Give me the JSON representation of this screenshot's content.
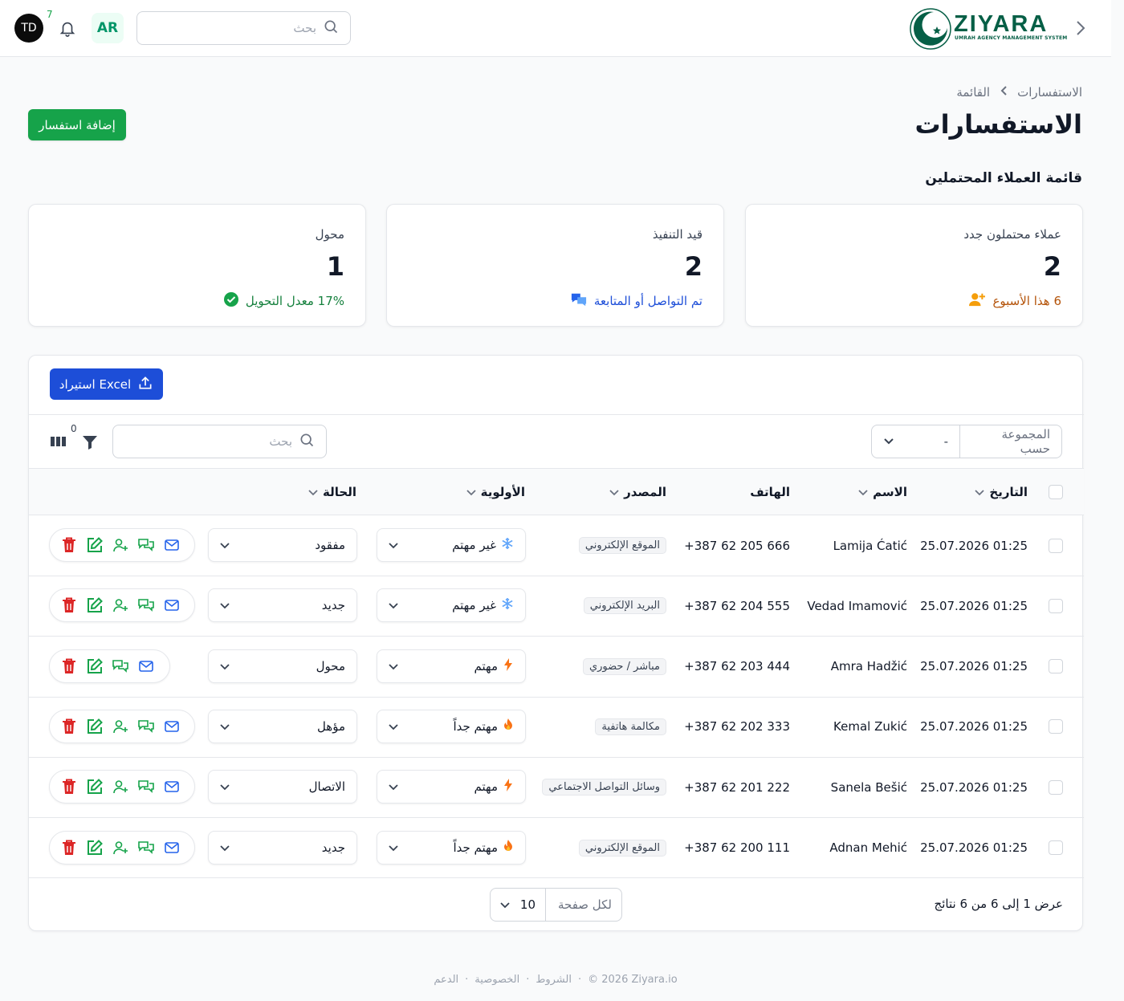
{
  "topbar": {
    "user_initials": "TD",
    "notifications_count": "7",
    "language": "AR",
    "search_placeholder": "بحث",
    "logo_text": "ZIYARA",
    "logo_subtitle": "UMRAH AGENCY MANAGEMENT SYSTEM"
  },
  "breadcrumb": {
    "root": "الاستفسارات",
    "current": "القائمة"
  },
  "page": {
    "title": "الاستفسارات",
    "subtitle": "قائمة العملاء المحتملين",
    "add_button": "إضافة استفسار"
  },
  "cards": [
    {
      "label": "عملاء محتملون جدد",
      "value": "2",
      "footer": "6 هذا الأسبوع",
      "footer_color": "#b45309",
      "icon": "user-plus-icon"
    },
    {
      "label": "قيد التنفيذ",
      "value": "2",
      "footer": "تم التواصل أو المتابعة",
      "footer_color": "#1d4ed8",
      "icon": "chat-bubbles-icon"
    },
    {
      "label": "محول",
      "value": "1",
      "footer": "17% معدل التحويل",
      "footer_color": "#15803d",
      "icon": "check-circle-icon"
    }
  ],
  "table_toolbar": {
    "excel_button": "استيراد Excel",
    "group_by_label": "المجموعة حسب",
    "group_by_value": "-",
    "search_placeholder": "بحث",
    "filter_count": "0"
  },
  "columns": {
    "date": "التاريخ",
    "name": "الاسم",
    "phone": "الهاتف",
    "source": "المصدر",
    "priority": "الأولوية",
    "status": "الحالة"
  },
  "rows": [
    {
      "date": "25.07.2026 01:25",
      "name": "Lamija Ćatić",
      "phone": "+387 62 205 666",
      "source": "الموقع الإلكتروني",
      "priority": "غير مهتم",
      "priority_icon": "snowflake-icon",
      "status": "مفقود",
      "convert": true
    },
    {
      "date": "25.07.2026 01:25",
      "name": "Vedad Imamović",
      "phone": "+387 62 204 555",
      "source": "البريد الإلكتروني",
      "priority": "غير مهتم",
      "priority_icon": "snowflake-icon",
      "status": "جديد",
      "convert": true
    },
    {
      "date": "25.07.2026 01:25",
      "name": "Amra Hadžić",
      "phone": "+387 62 203 444",
      "source": "مباشر / حضوري",
      "priority": "مهتم",
      "priority_icon": "bolt-icon",
      "status": "محول",
      "convert": false
    },
    {
      "date": "25.07.2026 01:25",
      "name": "Kemal Zukić",
      "phone": "+387 62 202 333",
      "source": "مكالمة هاتفية",
      "priority": "مهتم جداً",
      "priority_icon": "fire-icon",
      "status": "مؤهل",
      "convert": true
    },
    {
      "date": "25.07.2026 01:25",
      "name": "Sanela Bešić",
      "phone": "+387 62 201 222",
      "source": "وسائل التواصل الاجتماعي",
      "priority": "مهتم",
      "priority_icon": "bolt-icon",
      "status": "الاتصال",
      "convert": true
    },
    {
      "date": "25.07.2026 01:25",
      "name": "Adnan Mehić",
      "phone": "+387 62 200 111",
      "source": "الموقع الإلكتروني",
      "priority": "مهتم جداً",
      "priority_icon": "fire-icon",
      "status": "جديد",
      "convert": true
    }
  ],
  "pagination": {
    "summary": "عرض 1 إلى 6 من 6 نتائج",
    "per_page_label": "لكل صفحة",
    "per_page_value": "10"
  },
  "footer": {
    "copyright": "© 2026 Ziyara.io",
    "terms": "الشروط",
    "privacy": "الخصوصية",
    "support": "الدعم",
    "separator": "·"
  },
  "colors": {
    "primary_green": "#16a34a",
    "primary_blue": "#1d4ed8",
    "delete_red": "#dc2626"
  }
}
